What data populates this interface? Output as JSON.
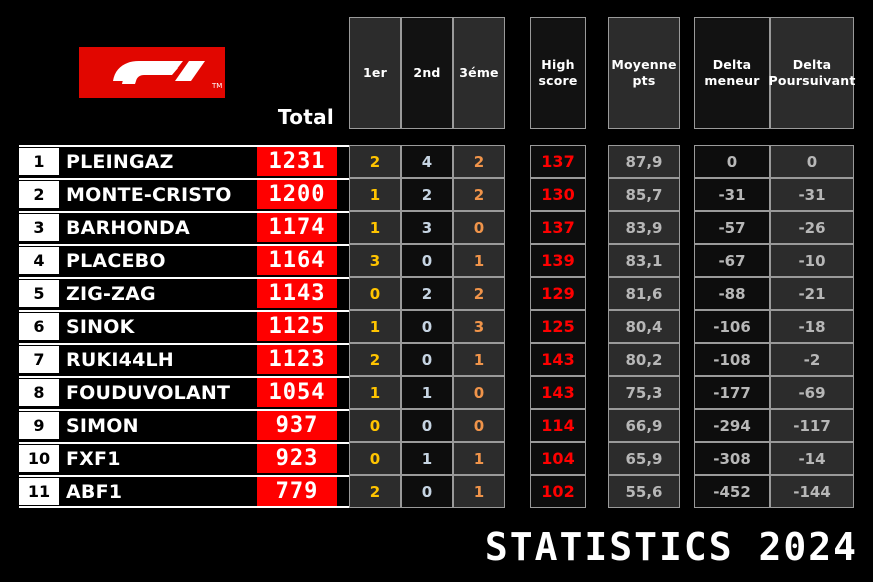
{
  "header": {
    "logo_alt": "f1-logo",
    "logo_tm": "TM",
    "total_label": "Total",
    "columns": [
      {
        "label": "1er",
        "tone": "light"
      },
      {
        "label": "2nd",
        "tone": "dark"
      },
      {
        "label": "3éme",
        "tone": "light"
      },
      {
        "label": "High\nscore",
        "tone": "dark"
      },
      {
        "label": "Moyenne\npts",
        "tone": "light"
      },
      {
        "label": "Delta\nmeneur",
        "tone": "dark"
      },
      {
        "label": "Delta\nPoursuivant",
        "tone": "light"
      }
    ]
  },
  "footer": {
    "title": "STATISTICS 2024"
  },
  "colors": {
    "f1_red": "#E10600",
    "score_red": "#FF0000",
    "gold": "#FFC400",
    "blue": "#c6d4e2",
    "orange": "#F0944A",
    "gray": "#b7b7b7",
    "cell_light": "#2c2c2c",
    "cell_dark": "#0d0d0d",
    "border": "#9a9a9a"
  },
  "table": {
    "columns": [
      "rank",
      "name",
      "total",
      "1er",
      "2nd",
      "3éme",
      "High score",
      "Moyenne pts",
      "Delta meneur",
      "Delta Poursuivant"
    ],
    "rows": [
      {
        "rank": "1",
        "name": "PLEINGAZ",
        "total": "1231",
        "first": "2",
        "second": "4",
        "third": "2",
        "high": "137",
        "avg": "87,9",
        "delta_leader": "0",
        "delta_chaser": "0"
      },
      {
        "rank": "2",
        "name": "MONTE-CRISTO",
        "total": "1200",
        "first": "1",
        "second": "2",
        "third": "2",
        "high": "130",
        "avg": "85,7",
        "delta_leader": "-31",
        "delta_chaser": "-31"
      },
      {
        "rank": "3",
        "name": "BARHONDA",
        "total": "1174",
        "first": "1",
        "second": "3",
        "third": "0",
        "high": "137",
        "avg": "83,9",
        "delta_leader": "-57",
        "delta_chaser": "-26"
      },
      {
        "rank": "4",
        "name": "PLACEBO",
        "total": "1164",
        "first": "3",
        "second": "0",
        "third": "1",
        "high": "139",
        "avg": "83,1",
        "delta_leader": "-67",
        "delta_chaser": "-10"
      },
      {
        "rank": "5",
        "name": "ZIG-ZAG",
        "total": "1143",
        "first": "0",
        "second": "2",
        "third": "2",
        "high": "129",
        "avg": "81,6",
        "delta_leader": "-88",
        "delta_chaser": "-21"
      },
      {
        "rank": "6",
        "name": "SINOK",
        "total": "1125",
        "first": "1",
        "second": "0",
        "third": "3",
        "high": "125",
        "avg": "80,4",
        "delta_leader": "-106",
        "delta_chaser": "-18"
      },
      {
        "rank": "7",
        "name": "RUKI44LH",
        "total": "1123",
        "first": "2",
        "second": "0",
        "third": "1",
        "high": "143",
        "avg": "80,2",
        "delta_leader": "-108",
        "delta_chaser": "-2"
      },
      {
        "rank": "8",
        "name": "FOUDUVOLANT",
        "total": "1054",
        "first": "1",
        "second": "1",
        "third": "0",
        "high": "143",
        "avg": "75,3",
        "delta_leader": "-177",
        "delta_chaser": "-69"
      },
      {
        "rank": "9",
        "name": "SIMON",
        "total": "937",
        "first": "0",
        "second": "0",
        "third": "0",
        "high": "114",
        "avg": "66,9",
        "delta_leader": "-294",
        "delta_chaser": "-117"
      },
      {
        "rank": "10",
        "name": "FXF1",
        "total": "923",
        "first": "0",
        "second": "1",
        "third": "1",
        "high": "104",
        "avg": "65,9",
        "delta_leader": "-308",
        "delta_chaser": "-14"
      },
      {
        "rank": "11",
        "name": "ABF1",
        "total": "779",
        "first": "2",
        "second": "0",
        "third": "1",
        "high": "102",
        "avg": "55,6",
        "delta_leader": "-452",
        "delta_chaser": "-144"
      }
    ]
  }
}
